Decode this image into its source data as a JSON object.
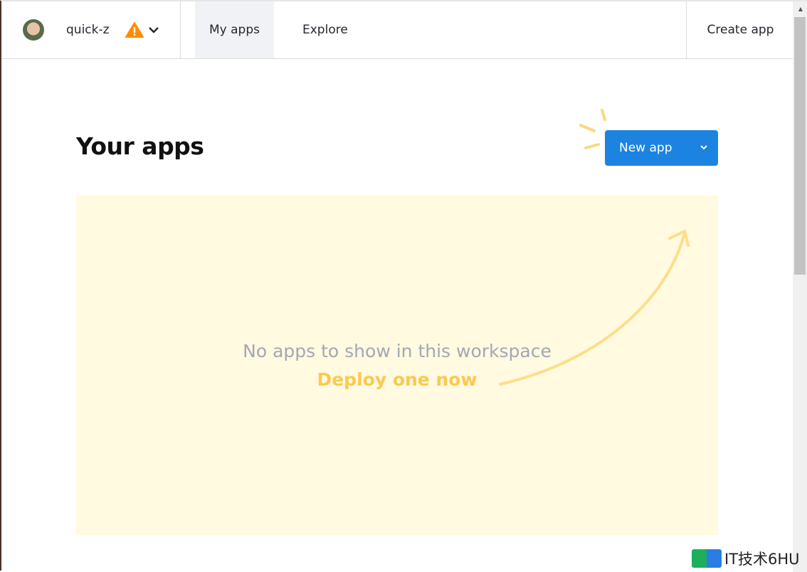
{
  "header": {
    "username": "quick-z",
    "tabs": [
      {
        "label": "My apps",
        "active": true
      },
      {
        "label": "Explore",
        "active": false
      }
    ],
    "create_app": "Create app"
  },
  "main": {
    "title": "Your apps",
    "new_app_button": "New app",
    "empty_message": "No apps to show in this workspace",
    "deploy_link": "Deploy one now"
  },
  "colors": {
    "accent": "#1c83e1",
    "warning": "#ff8c00",
    "deploy": "#fbc950",
    "empty_bg": "#fffae0"
  },
  "watermark": "IT技术6HU"
}
